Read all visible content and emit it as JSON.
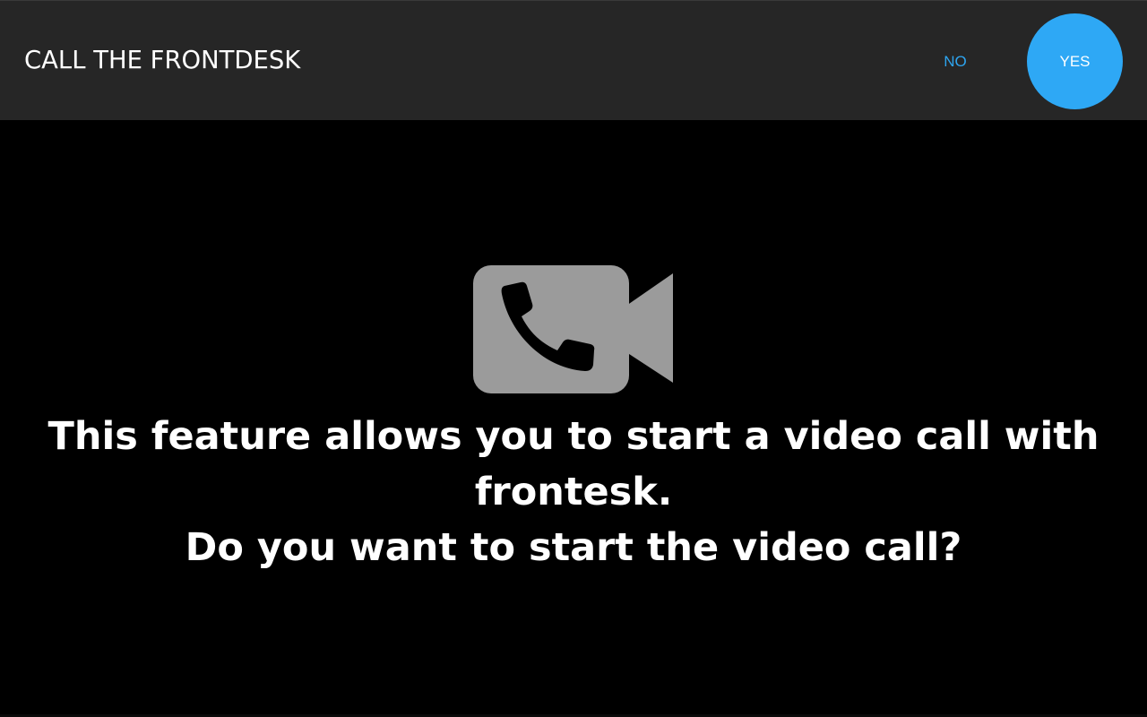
{
  "header": {
    "title": "CALL THE FRONTDESK",
    "no_label": "NO",
    "yes_label": "YES"
  },
  "main": {
    "icon": "video-call-phone-icon",
    "message_line1": "This feature allows you to start a video call with frontesk.",
    "message_line2": "Do you want to start the video call?"
  },
  "colors": {
    "header_background": "#262626",
    "page_background": "#000000",
    "accent": "#2ea8f5",
    "icon_gray": "#9b9b9b",
    "text": "#ffffff"
  }
}
